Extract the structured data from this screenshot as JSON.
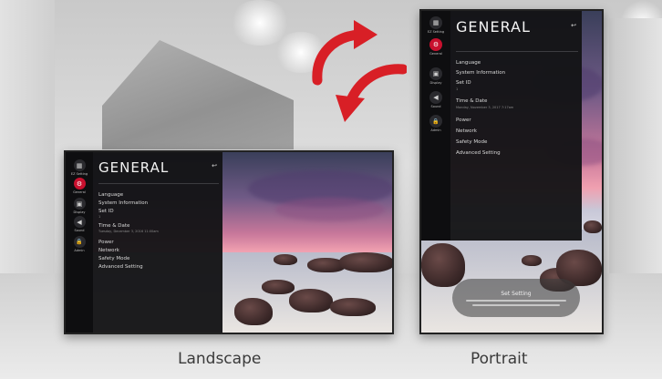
{
  "settings": {
    "title": "GENERAL",
    "back_glyph": "↩",
    "sidebar": [
      {
        "icon": "▦",
        "label": "EZ Setting",
        "icon_name": "ez-setting-icon",
        "active": false
      },
      {
        "icon": "⚙",
        "label": "General",
        "icon_name": "general-icon",
        "active": true
      },
      {
        "icon": "▣",
        "label": "Display",
        "icon_name": "display-icon",
        "active": false
      },
      {
        "icon": "◀",
        "label": "Sound",
        "icon_name": "sound-icon",
        "active": false
      },
      {
        "icon": "🔒",
        "label": "Admin",
        "icon_name": "admin-lock-icon",
        "active": false
      }
    ],
    "menu": {
      "language": "Language",
      "system_information": "System Information",
      "set_id": "Set ID",
      "set_id_value": "1",
      "time_date": "Time & Date",
      "time_date_value_landscape": "Tuesday, December 3, 2016 11:00am",
      "time_date_value_portrait": "Monday, November 3, 2017 7:17am",
      "power": "Power",
      "network": "Network",
      "safety_mode": "Safety Mode",
      "advanced_setting": "Advanced Setting"
    }
  },
  "toast": {
    "title": "Set Setting"
  },
  "captions": {
    "landscape": "Landscape",
    "portrait": "Portrait"
  },
  "colors": {
    "accent": "#c8102e",
    "arrow": "#d81f26",
    "panel": "#141416"
  }
}
